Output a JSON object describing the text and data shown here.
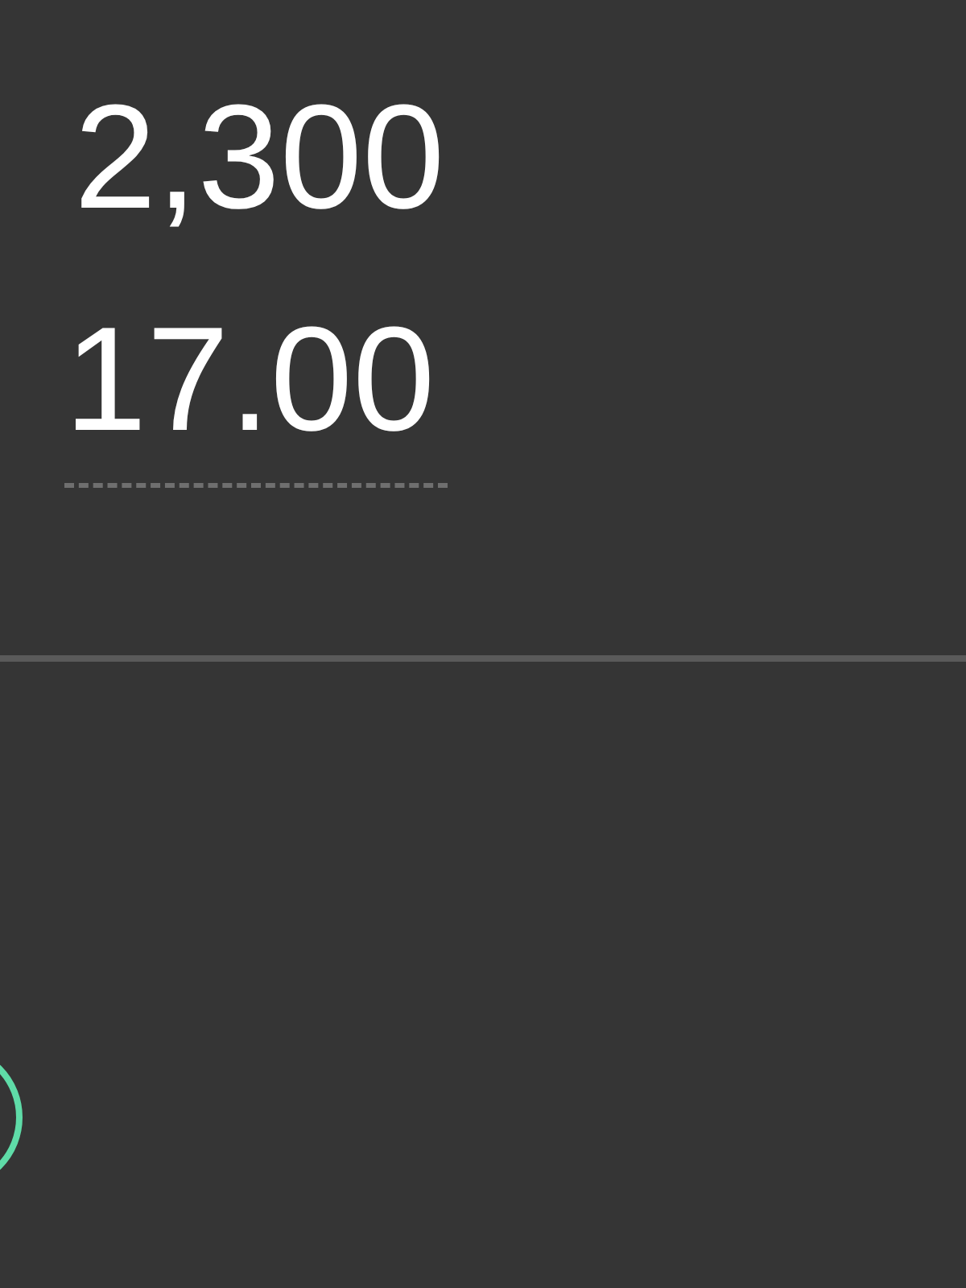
{
  "amount": {
    "text": "2,300"
  },
  "price_field": {
    "value": "17.00"
  }
}
